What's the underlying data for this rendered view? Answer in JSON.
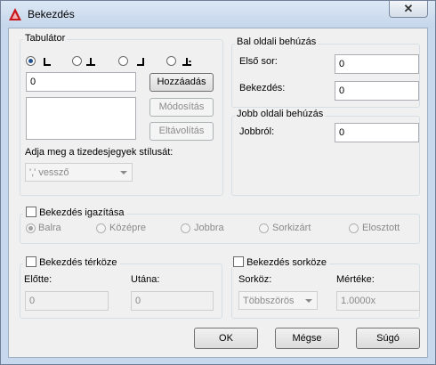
{
  "window": {
    "title": "Bekezdés",
    "close_glyph": "✕"
  },
  "tabulator": {
    "group_label": "Tabulátor",
    "tab_types": [
      "left-tab-icon",
      "center-tab-icon",
      "right-tab-icon",
      "decimal-tab-icon"
    ],
    "selected_index": 0,
    "position_value": "0",
    "add_button": "Hozzáadás",
    "modify_button": "Módosítás",
    "remove_button": "Eltávolítás",
    "decimal_style_label": "Adja meg a tizedesjegyek stílusát:",
    "decimal_style_value": "',' vessző"
  },
  "left_indent": {
    "group_label": "Bal oldali behúzás",
    "first_line_label": "Első sor:",
    "first_line_value": "0",
    "paragraph_label": "Bekezdés:",
    "paragraph_value": "0"
  },
  "right_indent": {
    "group_label": "Jobb oldali behúzás",
    "from_right_label": "Jobbról:",
    "from_right_value": "0"
  },
  "alignment": {
    "checkbox_label": "Bekezdés igazítása",
    "checked": false,
    "options": [
      "Balra",
      "Középre",
      "Jobbra",
      "Sorkizárt",
      "Elosztott"
    ],
    "selected_index": 0
  },
  "spacing": {
    "checkbox_label": "Bekezdés térköze",
    "before_label": "Előtte:",
    "before_value": "0",
    "after_label": "Utána:",
    "after_value": "0"
  },
  "line_spacing": {
    "checkbox_label": "Bekezdés sorköze",
    "mode_label": "Sorköz:",
    "mode_value": "Többszörös",
    "amount_label": "Mértéke:",
    "amount_value": "1.0000x"
  },
  "footer": {
    "ok": "OK",
    "cancel": "Mégse",
    "help": "Súgó"
  },
  "colors": {
    "app_icon": "#c8161d",
    "frame": "#c7d8ec",
    "selected_radio": "#1f4f8f"
  }
}
